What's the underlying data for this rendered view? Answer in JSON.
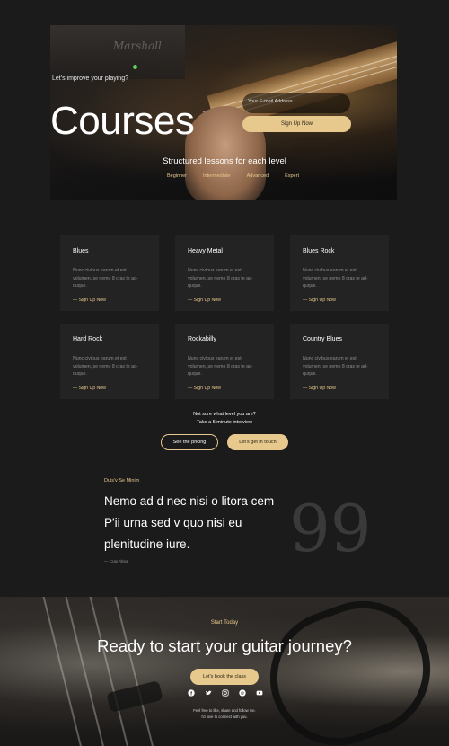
{
  "hero": {
    "tagline": "Let's improve your playing?",
    "title": "Courses",
    "email_placeholder": "Your E-mail Address",
    "signup_label": "Sign Up Now",
    "subtitle": "Structured lessons for each level",
    "levels": [
      "Beginner",
      "Intermediate",
      "Advanced",
      "Expert"
    ],
    "amp_logo": "Marshall"
  },
  "courses": [
    {
      "title": "Blues",
      "desc": "Nunc civibus earum et est volumen, se nemo 8 cras te ad- quque.",
      "link": "— Sign Up Now"
    },
    {
      "title": "Heavy Metal",
      "desc": "Nunc civibus earum et est volumen, se nemo 8 cras te ad- quque.",
      "link": "— Sign Up Now"
    },
    {
      "title": "Blues Rock",
      "desc": "Nunc civibus earum et est volumen, se nemo 8 cras te ad- quque.",
      "link": "— Sign Up Now"
    },
    {
      "title": "Hard Rock",
      "desc": "Nunc civibus earum et est volumen, se nemo 8 cras te ad- quque.",
      "link": "— Sign Up Now"
    },
    {
      "title": "Rockabilly",
      "desc": "Nunc civibus earum et est volumen, se nemo 8 cras te ad- quque.",
      "link": "— Sign Up Now"
    },
    {
      "title": "Country Blues",
      "desc": "Nunc civibus earum et est volumen, se nemo 8 cras te ad- quque.",
      "link": "— Sign Up Now"
    }
  ],
  "level_prompt": {
    "line1": "Not sure what level you are?",
    "line2": "Take a 5 minute interview",
    "pricing_label": "See the pricing",
    "contact_label": "Let's get in touch"
  },
  "testimonial": {
    "eyebrow": "Duis'v Se Minim",
    "quote": "Nemo ad d nec nisi o litora cem P'ii urna sed v quo nisi eu plenitudine iure.",
    "author": "— Cras Altea",
    "mark": "99"
  },
  "cta": {
    "eyebrow": "Start Today",
    "title": "Ready to start your guitar journey?",
    "button_label": "Let's book the class",
    "social_icons": [
      "facebook-icon",
      "twitter-icon",
      "instagram-icon",
      "spotify-icon",
      "youtube-icon"
    ],
    "note_line1": "Feel free to like, share and follow me.",
    "note_line2": "I'd love to connect with you."
  },
  "colors": {
    "accent": "#e8c98d",
    "background": "#1b1b1b",
    "card": "#232323",
    "muted": "#8e8e8e"
  }
}
